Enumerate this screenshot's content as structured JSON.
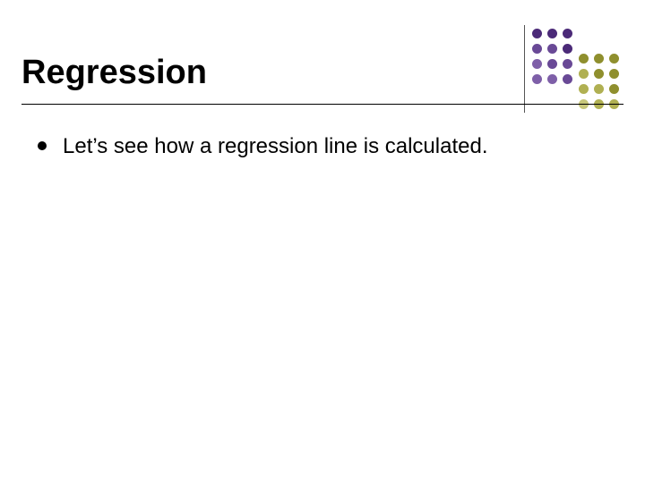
{
  "slide": {
    "title": "Regression",
    "bullets": [
      {
        "text": "Let’s see how a regression line is calculated."
      }
    ]
  },
  "decoration": {
    "top_colors": [
      "#4b2a78",
      "#694996",
      "#7e5fa8"
    ],
    "bottom_colors": [
      "#8f8f2e",
      "#b0b052",
      "#c7c77a"
    ]
  }
}
